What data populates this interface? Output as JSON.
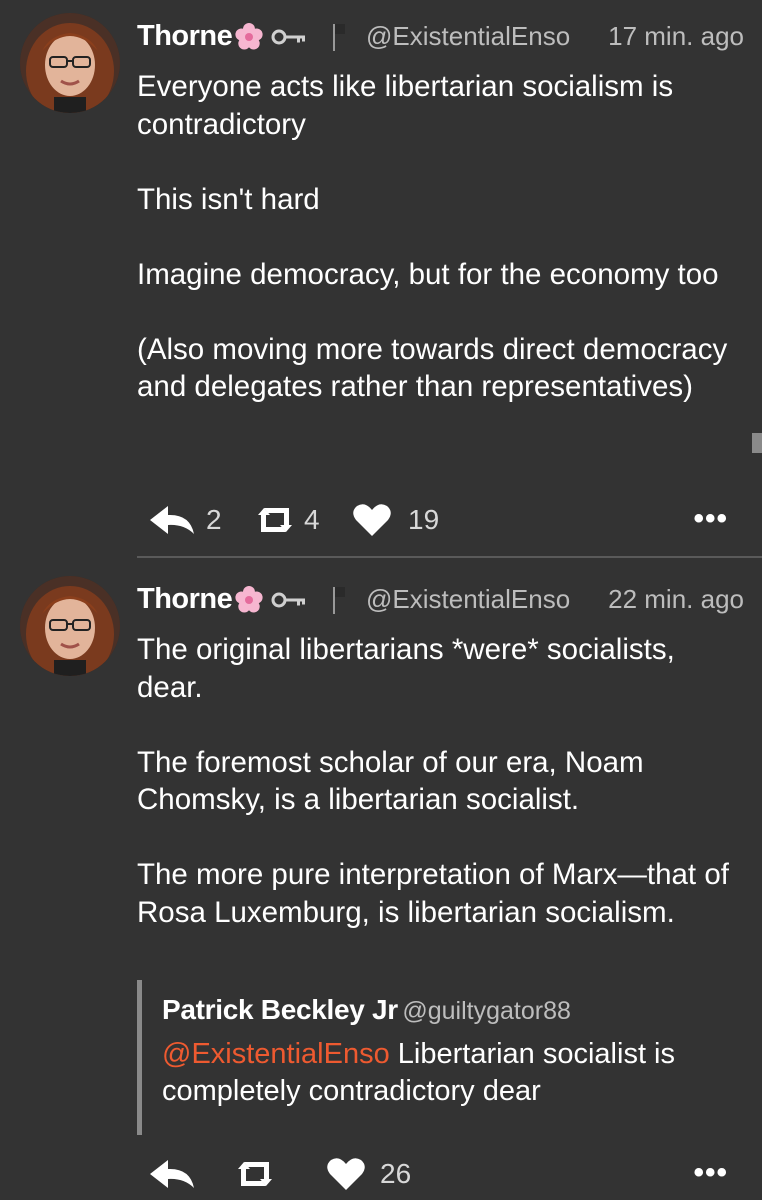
{
  "tweets": [
    {
      "name": "Thorne",
      "handle": "@ExistentialEnso",
      "time": "17 min. ago",
      "paragraphs": [
        "Everyone acts like libertarian socialism is contradictory",
        "This isn't hard",
        "Imagine democracy, but for the economy too",
        "(Also moving more towards direct democracy and delegates rather than representatives)"
      ],
      "replies": "2",
      "retweets": "4",
      "likes": "19"
    },
    {
      "name": "Thorne",
      "handle": "@ExistentialEnso",
      "time": "22 min. ago",
      "paragraphs": [
        "The original libertarians *were* socialists, dear.",
        "The foremost scholar of our era, Noam Chomsky, is a libertarian socialist.",
        "The more pure interpretation of Marx—that of Rosa Luxemburg, is libertarian socialism."
      ],
      "quote": {
        "name": "Patrick Beckley Jr",
        "handle": "@guiltygator88",
        "mention": "@ExistentialEnso",
        "text": " Libertarian socialist is completely contradictory dear"
      },
      "replies": "",
      "retweets": "",
      "likes": "26"
    }
  ],
  "more_label": "•••",
  "colors": {
    "background": "#333333",
    "mention": "#ee5a30",
    "secondary_text": "#bdbdbd"
  },
  "icons": [
    "cherry-blossom-icon",
    "key-icon",
    "flag-icon",
    "reply-icon",
    "retweet-icon",
    "heart-icon",
    "more-icon"
  ]
}
